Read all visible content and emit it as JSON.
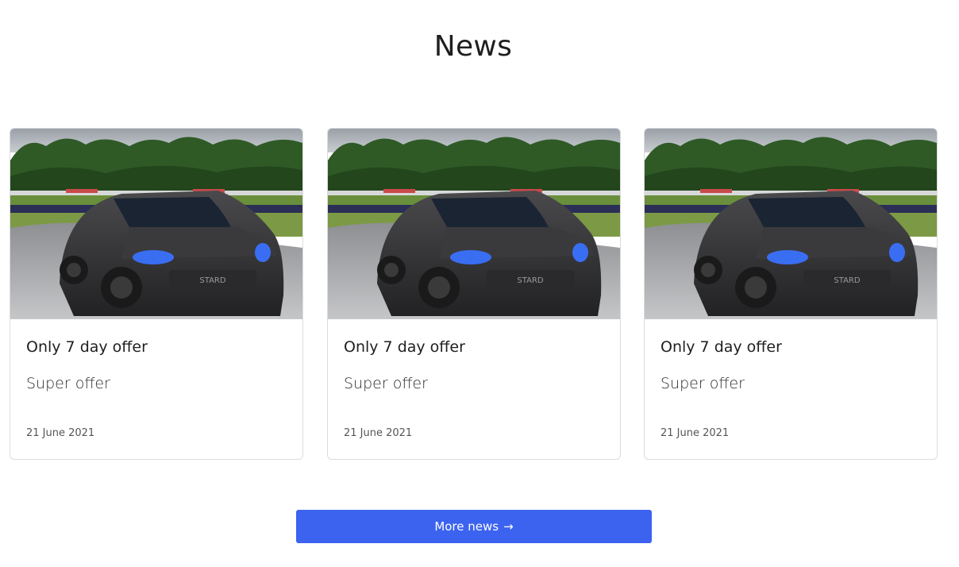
{
  "section": {
    "title": "News"
  },
  "news": [
    {
      "title": "Only 7 day offer",
      "subtitle": "Super offer",
      "date": "21 June 2021",
      "image": "rally-car-photo"
    },
    {
      "title": "Only 7 day offer",
      "subtitle": "Super offer",
      "date": "21 June 2021",
      "image": "rally-car-photo"
    },
    {
      "title": "Only 7 day offer",
      "subtitle": "Super offer",
      "date": "21 June 2021",
      "image": "rally-car-photo"
    }
  ],
  "more_button": {
    "label": "More news",
    "arrow": "→"
  },
  "colors": {
    "accent": "#3c63f0",
    "text": "#1f1f1f",
    "muted": "#555555",
    "border": "#dcdcdc"
  }
}
